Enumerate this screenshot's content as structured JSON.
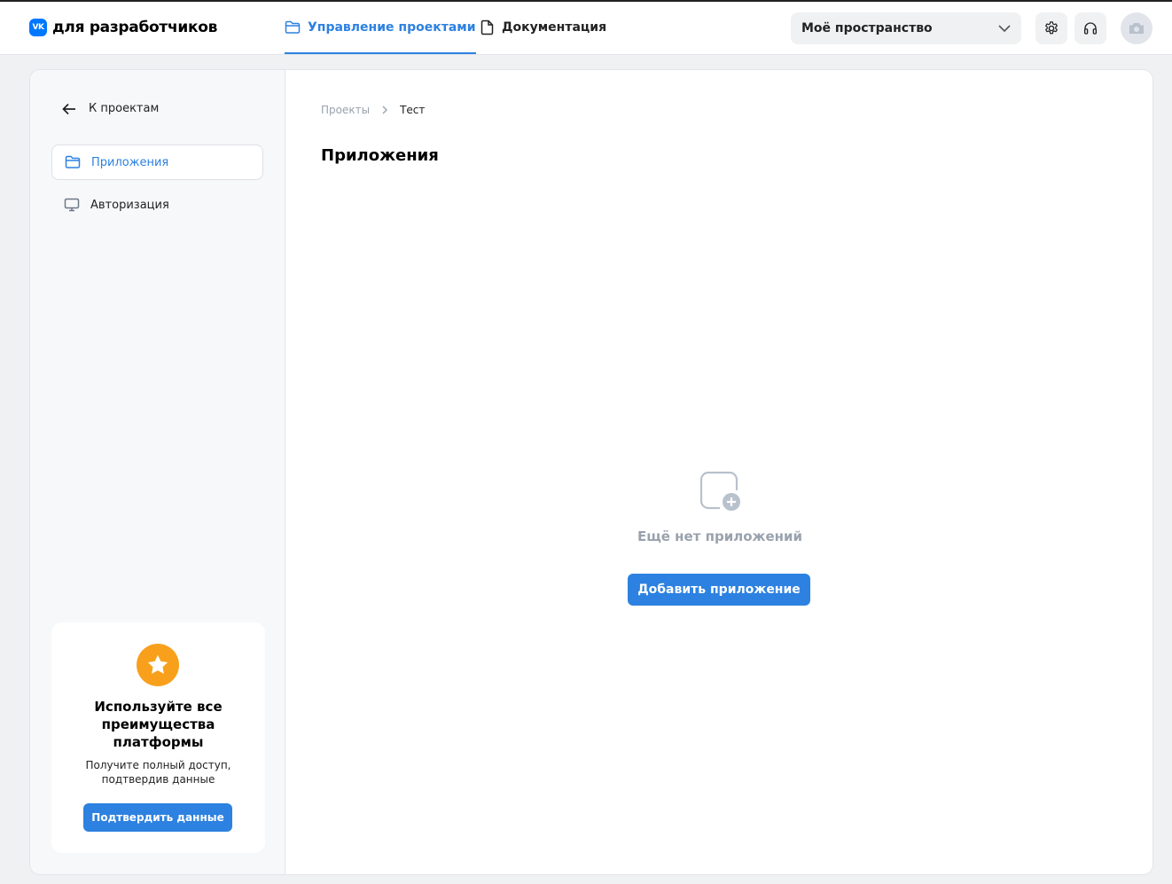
{
  "header": {
    "logo_badge": "VK",
    "logo_text": "для разработчиков",
    "nav": {
      "projects": "Управление проектами",
      "docs": "Документация"
    },
    "workspace": "Моё пространство"
  },
  "sidebar": {
    "back": "К проектам",
    "items": [
      {
        "label": "Приложения",
        "icon": "folder-icon",
        "active": true
      },
      {
        "label": "Авторизация",
        "icon": "monitor-icon",
        "active": false
      }
    ],
    "promo": {
      "title": "Используйте все преимущества платформы",
      "subtitle": "Получите полный доступ, подтвердив данные",
      "button": "Подтвердить данные"
    }
  },
  "main": {
    "breadcrumb": [
      "Проекты",
      "Тест"
    ],
    "title": "Приложения",
    "empty_text": "Ещё нет приложений",
    "add_button": "Добавить приложение"
  },
  "colors": {
    "accent": "#2d81e0",
    "vk_blue": "#0077ff",
    "star": "#f8a01c",
    "muted": "#99a2ad"
  }
}
